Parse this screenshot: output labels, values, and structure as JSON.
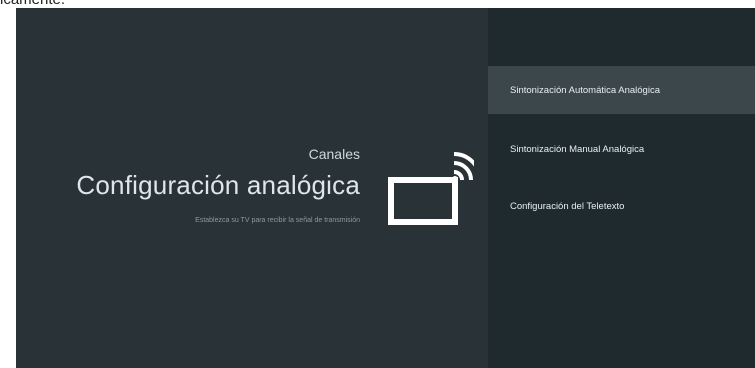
{
  "top_text": "lcamente.",
  "left": {
    "section_label": "Canales",
    "title": "Configuración analógica",
    "subtitle": "Establezca su TV para recibir la señal de transmisión"
  },
  "menu": {
    "items": [
      {
        "label": "Sintonización Automática Analógica",
        "selected": true
      },
      {
        "label": "Sintonización Manual Analógica",
        "selected": false
      },
      {
        "label": "Configuración del Teletexto",
        "selected": false
      }
    ]
  },
  "colors": {
    "left_bg": "#283237",
    "right_bg": "#1f2a2f",
    "selected_bg": "#3c474c",
    "text": "#e8eef0"
  },
  "icons": {
    "cast": "cast-tv-icon"
  }
}
